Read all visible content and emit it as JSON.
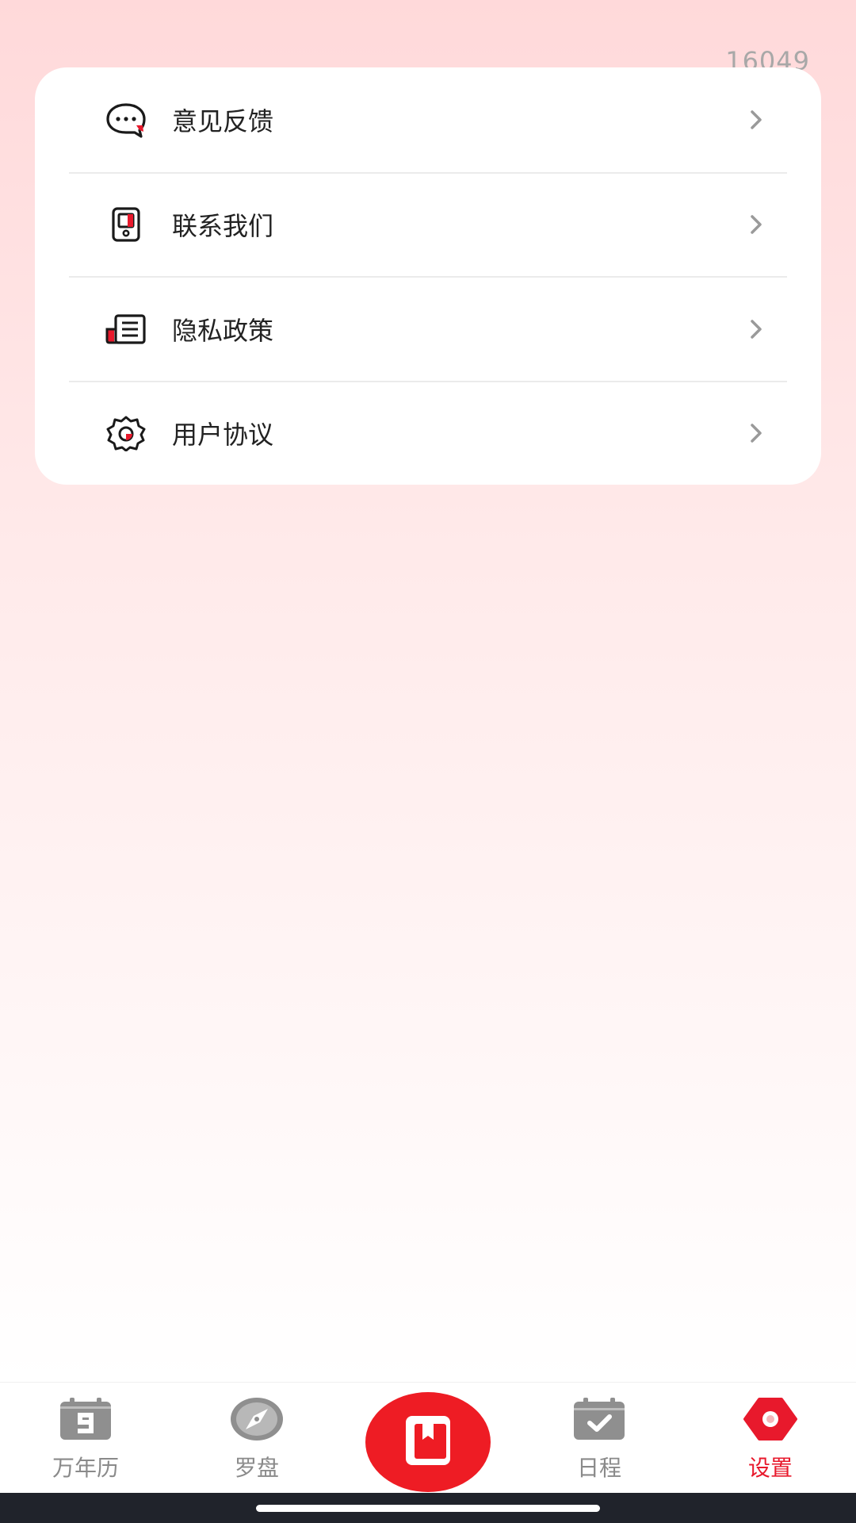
{
  "version": "16049",
  "menu": {
    "items": [
      {
        "label": "意见反馈",
        "icon": "feedback-chat-icon"
      },
      {
        "label": "联系我们",
        "icon": "contact-phone-icon"
      },
      {
        "label": "隐私政策",
        "icon": "privacy-document-icon"
      },
      {
        "label": "用户协议",
        "icon": "user-agreement-gear-icon"
      }
    ]
  },
  "tabbar": {
    "tabs": [
      {
        "label": "万年历",
        "icon": "calendar-icon",
        "active": false
      },
      {
        "label": "罗盘",
        "icon": "compass-icon",
        "active": false
      },
      {
        "label": "日程",
        "icon": "schedule-check-icon",
        "active": false
      },
      {
        "label": "设置",
        "icon": "settings-hexagon-icon",
        "active": true
      }
    ],
    "center_icon": "book-icon"
  },
  "colors": {
    "accent": "#e8192c",
    "center_button": "#ee1c24",
    "inactive": "#8a8a8a"
  }
}
